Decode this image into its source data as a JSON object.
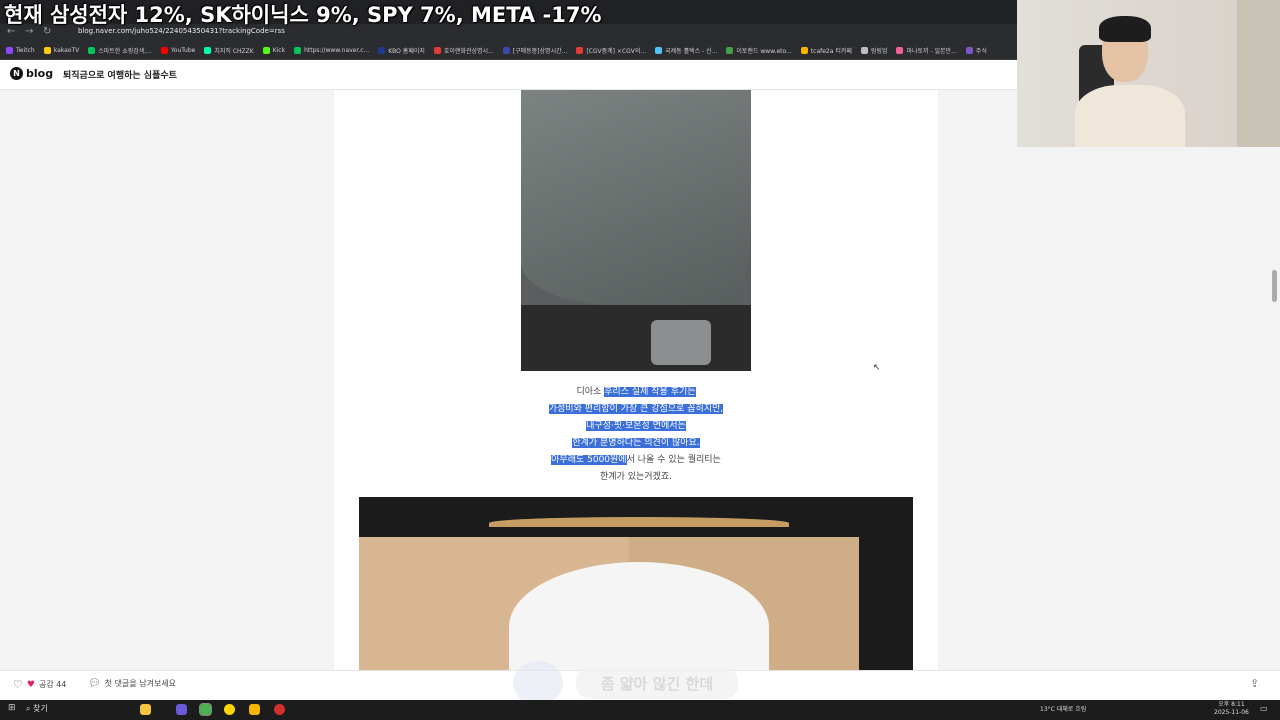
{
  "stream": {
    "title": "현재 삼성전자 12%, SK하이닉스 9%, SPY 7%, META -17%"
  },
  "browser": {
    "url": "blog.naver.com/juho524/224054350431?trackingCode=rss",
    "bookmarks": [
      {
        "label": "Twitch",
        "color": "#9146ff"
      },
      {
        "label": "kakaoTV",
        "color": "#ffcd00"
      },
      {
        "label": "스마트한 쇼핑검색,...",
        "color": "#03c75a"
      },
      {
        "label": "YouTube",
        "color": "#ff0000"
      },
      {
        "label": "치지직 CHZZK",
        "color": "#00ffa3"
      },
      {
        "label": "Kick",
        "color": "#53fc18"
      },
      {
        "label": "https://www.naver.c...",
        "color": "#03c75a"
      },
      {
        "label": "KBO 홈페이지",
        "color": "#1f3a93"
      },
      {
        "label": "호이랜화관상명시...",
        "color": "#e53935"
      },
      {
        "label": "[구매등봉]상명시간...",
        "color": "#3949ab"
      },
      {
        "label": "[CGV중계] ×CGV의...",
        "color": "#e53935"
      },
      {
        "label": "국제동 홀텍스 - 신...",
        "color": "#4fc3f7"
      },
      {
        "label": "이토랜드 www.eto...",
        "color": "#43a047"
      },
      {
        "label": "tcafe2a 티카페",
        "color": "#ffb300"
      },
      {
        "label": "링링업",
        "color": "#bdbdbd"
      },
      {
        "label": "마나토끼 - 일본만...",
        "color": "#f06292"
      },
      {
        "label": "주식",
        "color": "#7e57c2"
      }
    ]
  },
  "blog": {
    "logo_letter": "N",
    "logo_text": "blog",
    "title": "퇴직금으로 여행하는 심플수트"
  },
  "caption": {
    "lines": [
      {
        "pre": "디아소 ",
        "hl": "후리스 실제 착용 후기는",
        "post": ""
      },
      {
        "pre": "",
        "hl": "가성비와 편리함이 가장 큰 강점으로 꼽히지만,",
        "post": ""
      },
      {
        "pre": "",
        "hl": "내구성·핏·보온성 면에서는",
        "post": ""
      },
      {
        "pre": "",
        "hl": "한계가 분명하다는 의견이 많아요.",
        "post": ""
      },
      {
        "pre": "",
        "hl": "아무래도 5000원에",
        "post": "서 나올 수 있는 퀄리티는"
      },
      {
        "pre": "",
        "hl": "",
        "post": "한계가 있는거겠죠."
      }
    ]
  },
  "footer": {
    "like_label": "공감 44",
    "comment_label": "첫 댓글을 남겨보세요"
  },
  "overlay": {
    "subtitle": "좀 얇아 않긴 한데"
  },
  "taskbar": {
    "search_label": "찾기",
    "weather": "13°C  대체로 흐림",
    "time": "오후 8:11",
    "date": "2025-11-06"
  }
}
